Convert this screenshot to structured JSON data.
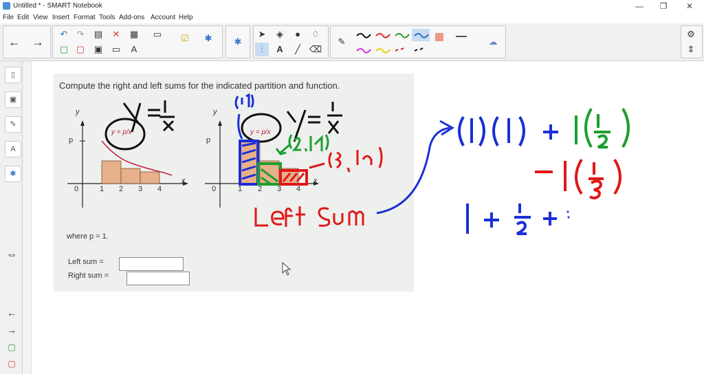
{
  "window": {
    "title": "Untitled * - SMART Notebook"
  },
  "menu": [
    "File",
    "Edit",
    "View",
    "Insert",
    "Format",
    "Tools",
    "Add-ons",
    "Account",
    "Help"
  ],
  "problem": {
    "question": "Compute the right and left sums for the indicated partition and function.",
    "graph_label_y": "y",
    "graph_label_p": "p",
    "graph_label_x": "x",
    "ticks": [
      "0",
      "1",
      "2",
      "3",
      "4"
    ],
    "function_label": "y = p/x",
    "where_text": "where p = 1.",
    "left_sum_label": "Left sum =",
    "right_sum_label": "Right sum ="
  },
  "handwriting": {
    "eq1": "y = 1/x",
    "eq2": "y = 1/x",
    "point_11": "(1,1)",
    "point_2": "(2, 1/2)",
    "point_3": "(3, 1/3)",
    "left_sum": "Left Sum",
    "expr_line1": "(1)(1) + 1(1/2)",
    "expr_line2": "+ 1(1/3)",
    "expr_line3": "1 + 1/2 + ..."
  },
  "colors": {
    "blue_ink": "#1a2fd6",
    "green_ink": "#1c9e2e",
    "red_ink": "#e01818",
    "black_ink": "#111111"
  }
}
